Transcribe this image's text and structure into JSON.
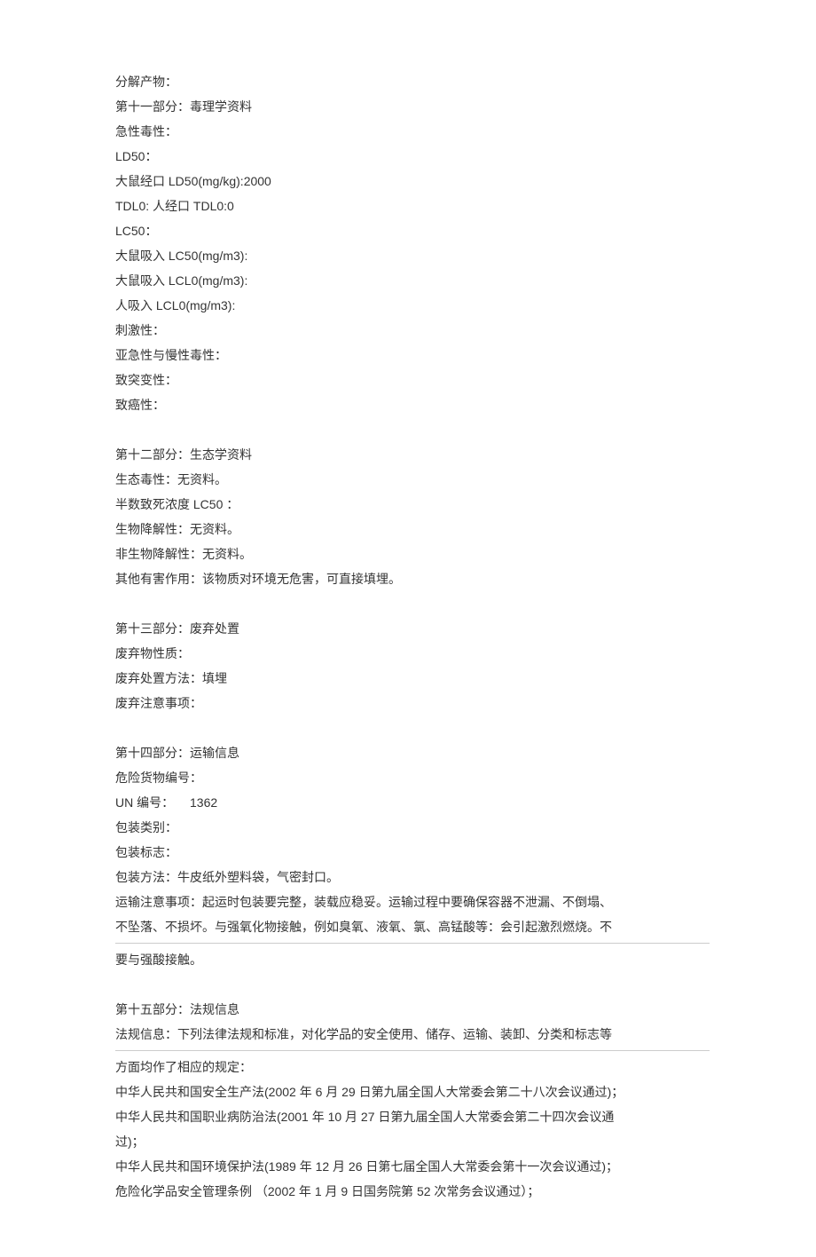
{
  "section10_tail": {
    "decomposition_products": "分解产物："
  },
  "section11": {
    "title": "第十一部分：毒理学资料",
    "acute_toxicity": "急性毒性：",
    "ld50_label": "LD50：",
    "rat_oral_ld50": "大鼠经口 LD50(mg/kg):2000",
    "tdl0": "TDL0: 人经口 TDL0:0",
    "lc50_label": "LC50：",
    "rat_inhale_lc50": "大鼠吸入 LC50(mg/m3):",
    "rat_inhale_lcl0": "大鼠吸入 LCL0(mg/m3):",
    "human_inhale_lcl0": "人吸入 LCL0(mg/m3):",
    "irritation": "刺激性：",
    "subacute_chronic": "亚急性与慢性毒性：",
    "mutagenicity": "致突变性：",
    "carcinogenicity": "致癌性："
  },
  "section12": {
    "title": "第十二部分：生态学资料",
    "ecotoxicity": "生态毒性：无资料。",
    "lc50": "半数致死浓度 LC50 ：",
    "biodegradability": "生物降解性：无资料。",
    "non_biodegradability": "非生物降解性：无资料。",
    "other_harmful": "其他有害作用：该物质对环境无危害，可直接填埋。"
  },
  "section13": {
    "title": "第十三部分：废弃处置",
    "waste_nature": "废弃物性质：",
    "disposal_method": "废弃处置方法：填埋",
    "disposal_precautions": "废弃注意事项："
  },
  "section14": {
    "title": "第十四部分：运输信息",
    "dangerous_goods_no": "危险货物编号：",
    "un_number": "UN 编号：  1362",
    "packaging_category": "包装类别：",
    "packaging_label": "包装标志：",
    "packaging_method": "包装方法：牛皮纸外塑料袋，气密封口。",
    "transport_precautions_1": "运输注意事项：起运时包装要完整，装载应稳妥。运输过程中要确保容器不泄漏、不倒塌、",
    "transport_precautions_2": "不坠落、不损坏。与强氧化物接触，例如臭氧、液氧、氯、高锰酸等：会引起激烈燃烧。不",
    "transport_precautions_3": "要与强酸接触。"
  },
  "section15": {
    "title": "第十五部分：法规信息",
    "regulatory_info_1": "法规信息：下列法律法规和标准，对化学品的安全使用、储存、运输、装卸、分类和标志等",
    "regulatory_info_2": "方面均作了相应的规定：",
    "law_safety_production": "中华人民共和国安全生产法(2002 年 6 月 29 日第九届全国人大常委会第二十八次会议通过)；",
    "law_occupational_disease_1": "中华人民共和国职业病防治法(2001 年 10 月 27 日第九届全国人大常委会第二十四次会议通",
    "law_occupational_disease_2": "过)；",
    "law_environmental_protection": "中华人民共和国环境保护法(1989 年 12 月 26 日第七届全国人大常委会第十一次会议通过)；",
    "law_hazardous_chemicals": "危险化学品安全管理条例 （2002 年 1 月 9 日国务院第 52 次常务会议通过）；"
  }
}
